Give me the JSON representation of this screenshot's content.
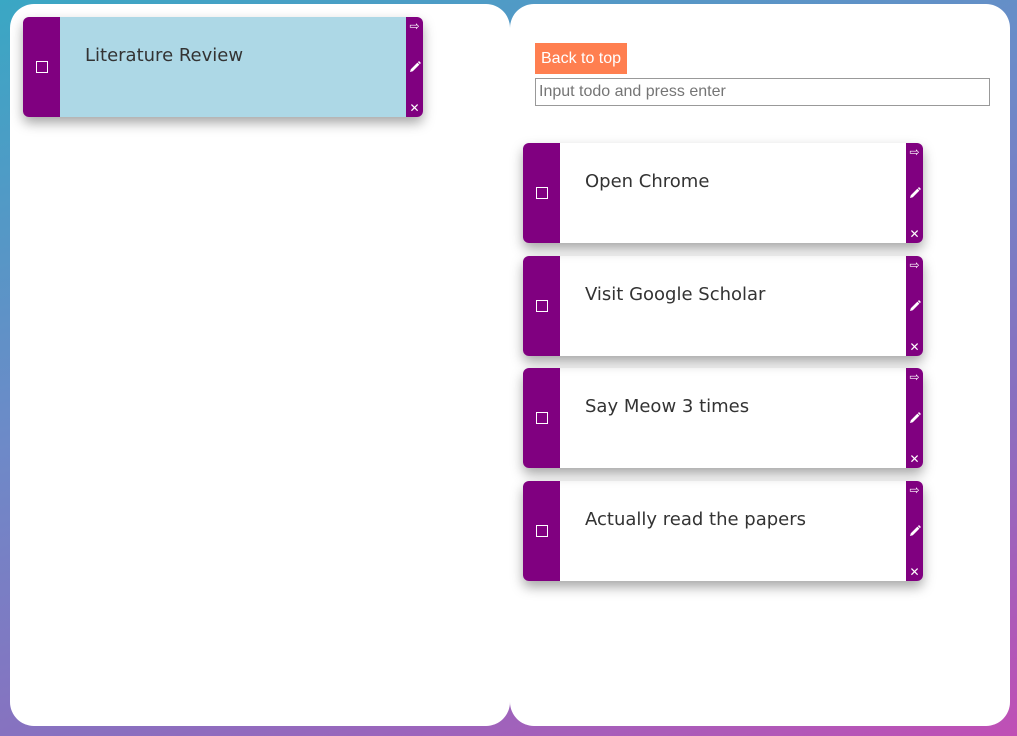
{
  "icons": {
    "checkbox": "square-outline",
    "move": "right-arrow",
    "edit": "pencil",
    "delete": "x"
  },
  "glyphs": {
    "move": "⇨",
    "delete": "✕"
  },
  "colors": {
    "card_strip": "#800080",
    "selected_card": "#add8e6",
    "back_button": "#ff7f50"
  },
  "left_panel": {
    "todos": [
      {
        "text": "Literature Review"
      }
    ]
  },
  "right_panel": {
    "back_button_label": "Back to top",
    "input": {
      "value": "",
      "placeholder": "Input todo and press enter"
    },
    "todos": [
      {
        "text": "Open Chrome"
      },
      {
        "text": "Visit Google Scholar"
      },
      {
        "text": "Say Meow 3 times"
      },
      {
        "text": "Actually read the papers"
      }
    ]
  }
}
